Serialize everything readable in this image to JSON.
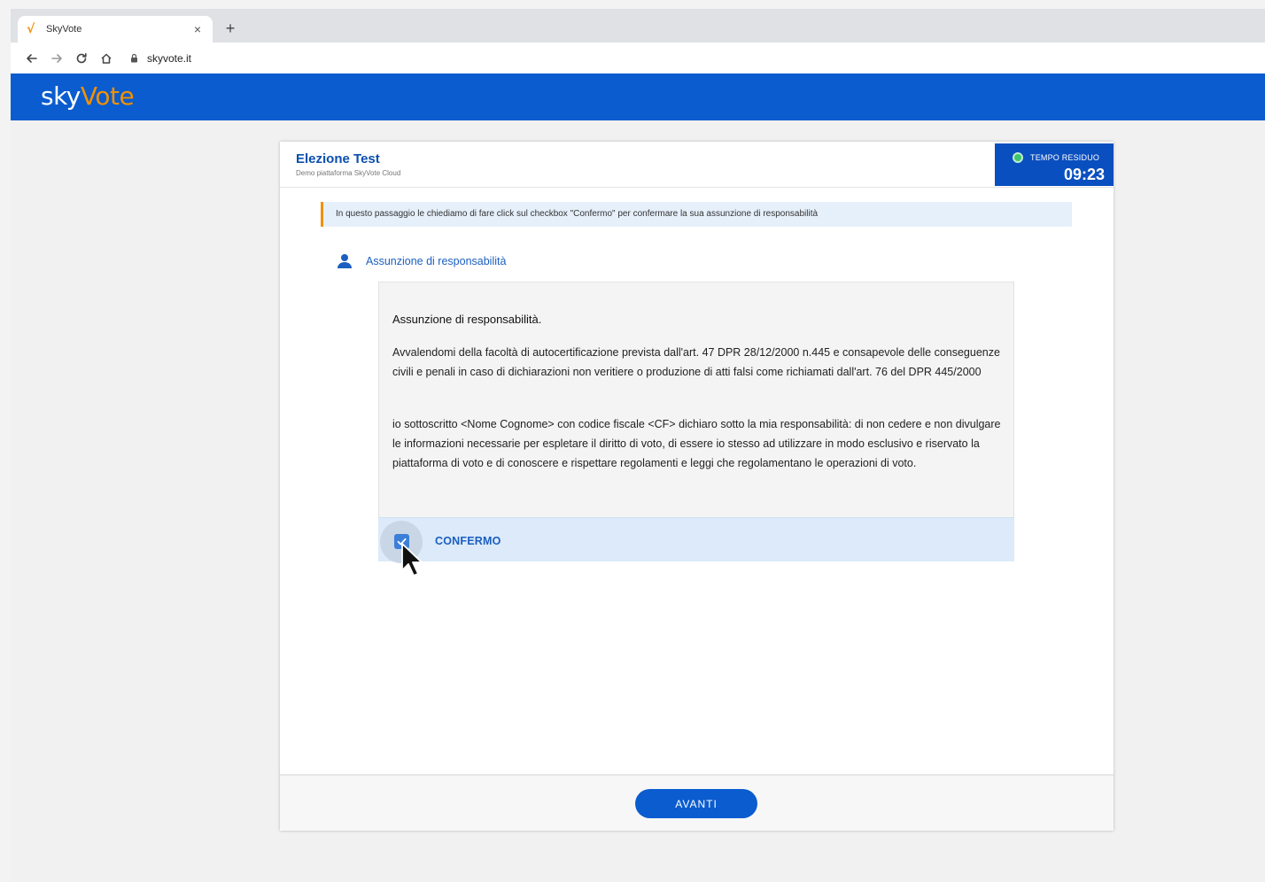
{
  "browser": {
    "tab_title": "SkyVote",
    "tab_close": "×",
    "new_tab": "+",
    "url": "skyvote.it"
  },
  "app": {
    "logo_prefix": "sky",
    "logo_accent": "Vote",
    "brand_color": "#0a5ccf",
    "accent_color": "#f29100"
  },
  "election": {
    "title": "Elezione Test",
    "subtitle": "Demo piattaforma SkyVote Cloud"
  },
  "timer": {
    "label": "TEMPO RESIDUO",
    "value": "09:23",
    "status_color": "#3ec46d"
  },
  "notice": "In questo passaggio le chiediamo di fare click sul checkbox \"Confermo\" per confermare la sua assunzione di responsabilità",
  "section": {
    "title": "Assunzione di responsabilità",
    "icon": "user-icon"
  },
  "declaration": {
    "heading": "Assunzione di responsabilità.",
    "paragraph1": "Avvalendomi della facoltà di autocertificazione prevista dall'art. 47 DPR 28/12/2000 n.445 e consapevole delle conseguenze civili e penali in caso di dichiarazioni non veritiere o produzione di atti falsi come richiamati dall'art. 76 del DPR 445/2000",
    "paragraph2": "io sottoscritto <Nome Cognome> con codice fiscale <CF> dichiaro sotto la mia responsabilità: di non cedere e non divulgare le informazioni necessarie per espletare il diritto di voto, di essere io stesso ad utilizzare in modo esclusivo e riservato la piattaforma di voto e di conoscere e rispettare regolamenti e leggi che regolamentano le operazioni di voto."
  },
  "confirm": {
    "label": "CONFERMO",
    "checked": true
  },
  "footer": {
    "next_label": "AVANTI"
  }
}
